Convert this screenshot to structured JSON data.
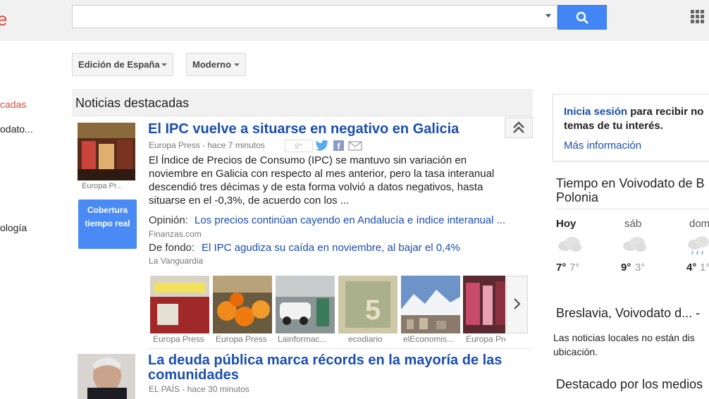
{
  "header": {
    "logo_fragment": "e",
    "search": {
      "value": "",
      "placeholder": ""
    }
  },
  "toolbar": {
    "edition_label": "Edición de España",
    "mode_label": "Moderno"
  },
  "leftnav": {
    "items": [
      "cadas",
      "odato...",
      "ología"
    ]
  },
  "section": {
    "title": "Noticias destacadas"
  },
  "article1": {
    "title": "El IPC vuelve a situarse en negativo en Galicia",
    "meta": "Europa Press - hace 7 minutos",
    "image_caption": "Europa Pr...",
    "coverage_label": "Cobertura tiempo real",
    "body": "El Índice de Precios de Consumo (IPC) se mantuvo sin variación en noviembre en Galicia con respecto al mes anterior, pero la tasa interanual descendió tres décimas y de esta forma volvió a datos negativos, hasta situarse en el -0,3%, de acuerdo con los ...",
    "related": [
      {
        "label": "Opinión:",
        "link": "Los precios continúan cayendo en Andalucía e índice interanual ...",
        "source": "Finanzas.com"
      },
      {
        "label": "De fondo:",
        "link": "El IPC agudiza su caída en noviembre, al bajar el 0,4%",
        "source": "La Vanguardia"
      }
    ],
    "image_strip": [
      {
        "caption": "Europa Press",
        "color": "#b33"
      },
      {
        "caption": "Europa Press",
        "color": "#e8801a"
      },
      {
        "caption": "Lainformac...",
        "color": "#9aa"
      },
      {
        "caption": "ecodiario",
        "color": "#bcb08a"
      },
      {
        "caption": "elEconomis...",
        "color": "#7fa0c8"
      },
      {
        "caption": "Europa Pre...",
        "color": "#8b4a5a"
      }
    ]
  },
  "article2": {
    "title_line1": "La deuda pública marca récords en la mayoría de las",
    "title_line2": "comunidades",
    "meta": "EL PAÍS - hace 30 minutos"
  },
  "signin": {
    "link": "Inicia sesión",
    "line1_rest": " para recibir no",
    "line2": "temas de tu interés.",
    "more": "Más información"
  },
  "weather": {
    "title_line1": "Tiempo en Voivodato de B",
    "title_line2": "Polonia",
    "days": [
      {
        "day": "Hoy",
        "hi": "7°",
        "lo": "7°"
      },
      {
        "day": "sáb",
        "hi": "9°",
        "lo": "3°"
      },
      {
        "day": "dom",
        "hi": "4°",
        "lo": "1°"
      }
    ]
  },
  "local": {
    "title": "Breslavia, Voivodato d... -",
    "notice_line1": "Las noticias locales no están dis",
    "notice_line2": "ubicación."
  },
  "featured": {
    "title": "Destacado por los medios"
  },
  "colors": {
    "accent": "#4285f4",
    "link": "#1a4db0",
    "logo": "#dd4b39"
  }
}
